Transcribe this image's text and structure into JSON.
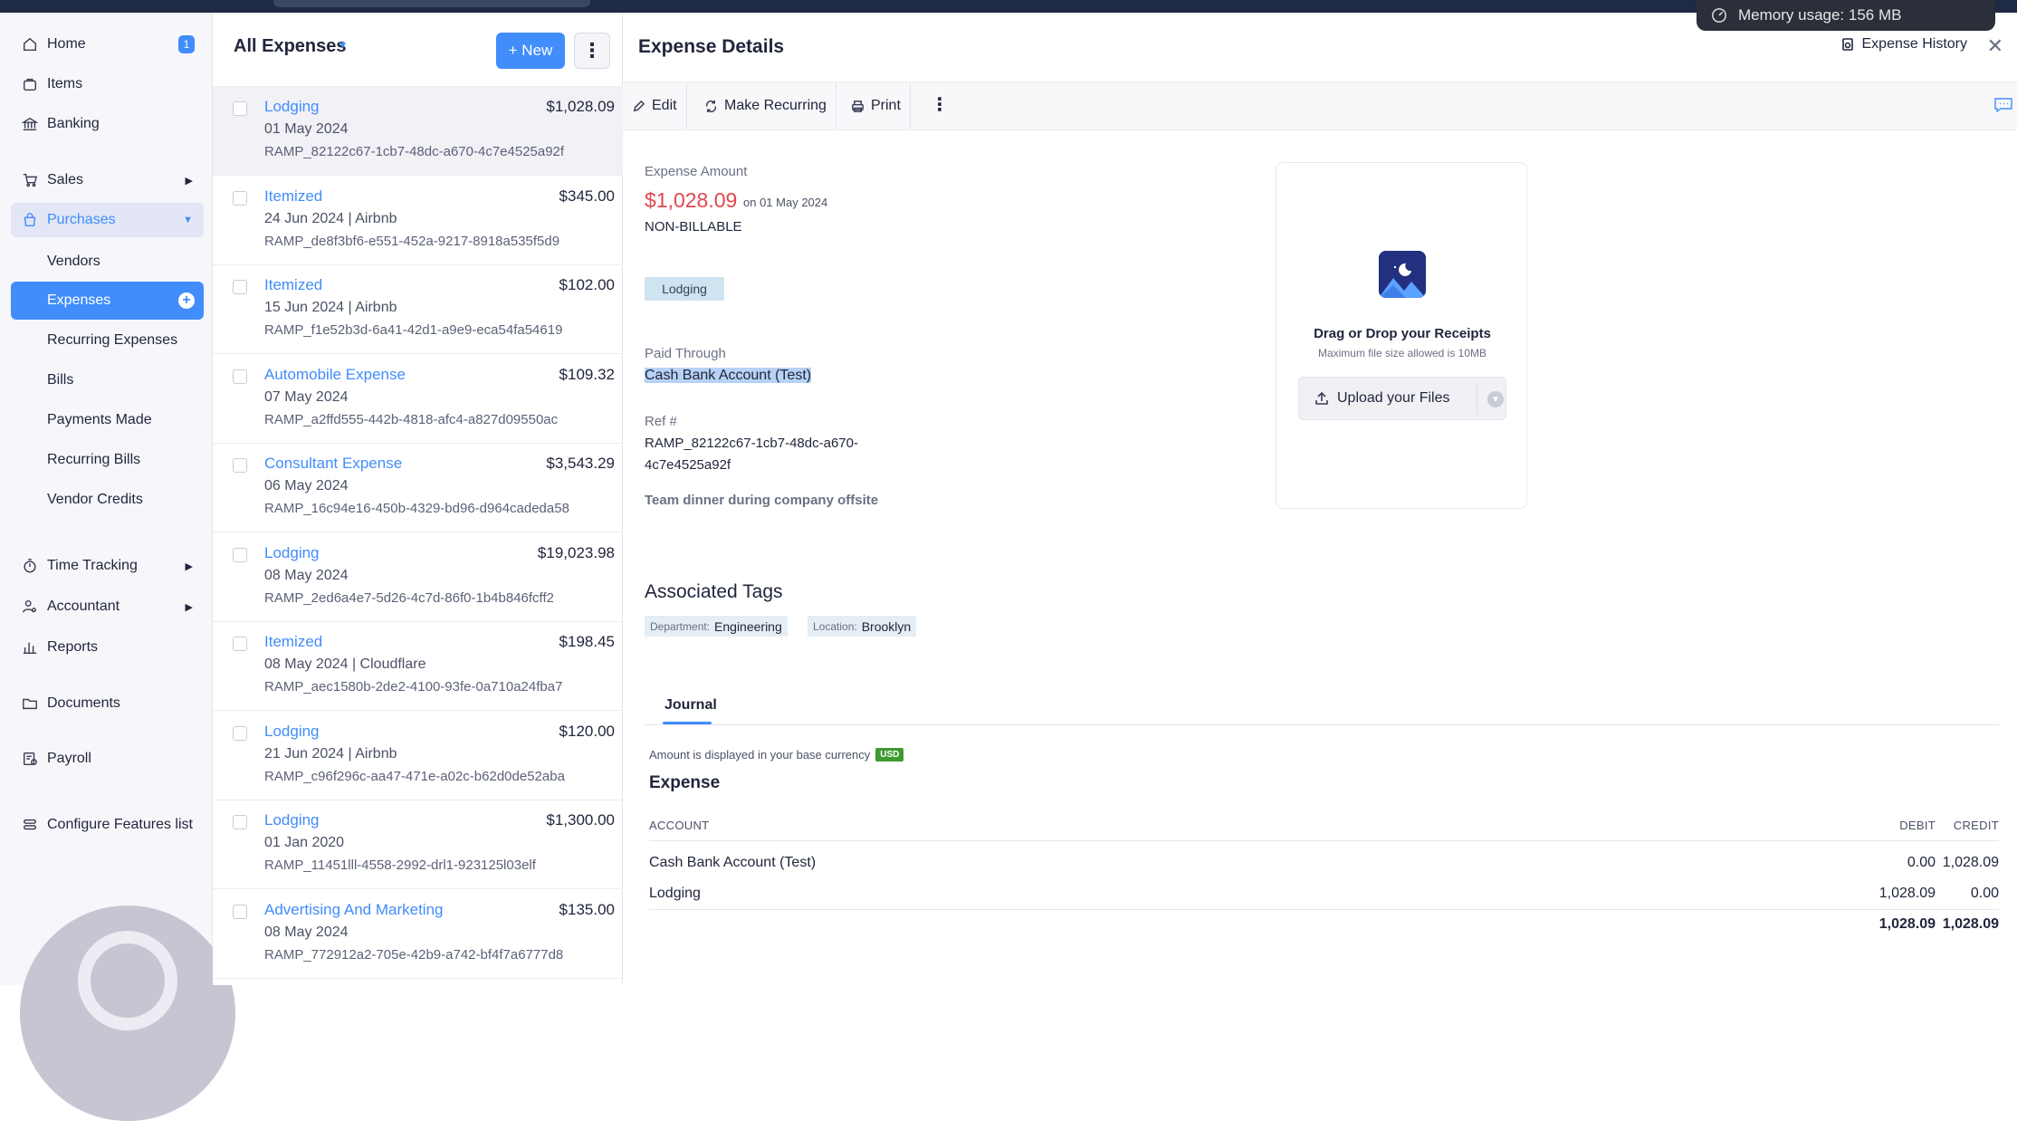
{
  "topbar": {
    "memory_usage": "Memory usage: 156 MB"
  },
  "sidebar": {
    "items": [
      {
        "label": "Home",
        "badge": "1"
      },
      {
        "label": "Items"
      },
      {
        "label": "Banking"
      },
      {
        "label": "Sales"
      },
      {
        "label": "Purchases"
      },
      {
        "label": "Time Tracking"
      },
      {
        "label": "Accountant"
      },
      {
        "label": "Reports"
      },
      {
        "label": "Documents"
      },
      {
        "label": "Payroll"
      },
      {
        "label": "Configure Features list"
      }
    ],
    "purchases_sub": [
      "Vendors",
      "Expenses",
      "Recurring Expenses",
      "Bills",
      "Payments Made",
      "Recurring Bills",
      "Vendor Credits"
    ]
  },
  "list": {
    "title": "All Expenses",
    "new_label": "+ New",
    "rows": [
      {
        "category": "Lodging",
        "amount": "$1,028.09",
        "date": "01 May 2024",
        "ref": "RAMP_82122c67-1cb7-48dc-a670-4c7e4525a92f"
      },
      {
        "category": "Itemized",
        "amount": "$345.00",
        "date": "24 Jun 2024 | Airbnb",
        "ref": "RAMP_de8f3bf6-e551-452a-9217-8918a535f5d9"
      },
      {
        "category": "Itemized",
        "amount": "$102.00",
        "date": "15 Jun 2024 | Airbnb",
        "ref": "RAMP_f1e52b3d-6a41-42d1-a9e9-eca54fa54619"
      },
      {
        "category": "Automobile Expense",
        "amount": "$109.32",
        "date": "07 May 2024",
        "ref": "RAMP_a2ffd555-442b-4818-afc4-a827d09550ac"
      },
      {
        "category": "Consultant Expense",
        "amount": "$3,543.29",
        "date": "06 May 2024",
        "ref": "RAMP_16c94e16-450b-4329-bd96-d964cadeda58"
      },
      {
        "category": "Lodging",
        "amount": "$19,023.98",
        "date": "08 May 2024",
        "ref": "RAMP_2ed6a4e7-5d26-4c7d-86f0-1b4b846fcff2"
      },
      {
        "category": "Itemized",
        "amount": "$198.45",
        "date": "08 May 2024 | Cloudflare",
        "ref": "RAMP_aec1580b-2de2-4100-93fe-0a710a24fba7"
      },
      {
        "category": "Lodging",
        "amount": "$120.00",
        "date": "21 Jun 2024 | Airbnb",
        "ref": "RAMP_c96f296c-aa47-471e-a02c-b62d0de52aba"
      },
      {
        "category": "Lodging",
        "amount": "$1,300.00",
        "date": "01 Jan 2020",
        "ref": "RAMP_11451lll-4558-2992-drl1-923125l03elf"
      },
      {
        "category": "Advertising And Marketing",
        "amount": "$135.00",
        "date": "08 May 2024",
        "ref": "RAMP_772912a2-705e-42b9-a742-bf4f7a6777d8"
      }
    ]
  },
  "detail": {
    "title": "Expense Details",
    "history_label": "Expense History",
    "toolbar": {
      "edit": "Edit",
      "make_recurring": "Make Recurring",
      "print": "Print"
    },
    "amount_label": "Expense Amount",
    "amount": "$1,028.09",
    "amount_on": "on 01 May 2024",
    "billable": "NON-BILLABLE",
    "category_tag": "Lodging",
    "paid_through_label": "Paid Through",
    "paid_through": "Cash Bank Account (Test)",
    "ref_label": "Ref #",
    "ref_line1": "RAMP_82122c67-1cb7-48dc-a670-",
    "ref_line2": "4c7e4525a92f",
    "notes": "Team dinner during company offsite",
    "receipt": {
      "title": "Drag or Drop your Receipts",
      "subtitle": "Maximum file size allowed is 10MB",
      "upload": "Upload your Files"
    },
    "associated_tags_title": "Associated Tags",
    "tags": [
      {
        "key": "Department:",
        "value": "Engineering"
      },
      {
        "key": "Location:",
        "value": "Brooklyn"
      }
    ],
    "journal": {
      "tab": "Journal",
      "base_currency_note": "Amount is displayed in your base currency",
      "currency": "USD",
      "section": "Expense",
      "headers": [
        "ACCOUNT",
        "DEBIT",
        "CREDIT"
      ],
      "rows": [
        {
          "account": "Cash Bank Account (Test)",
          "debit": "0.00",
          "credit": "1,028.09"
        },
        {
          "account": "Lodging",
          "debit": "1,028.09",
          "credit": "0.00"
        }
      ],
      "total_debit": "1,028.09",
      "total_credit": "1,028.09"
    }
  },
  "colors": {
    "accent": "#408dfb",
    "amount_red": "#e0484f",
    "usd_green": "#3f9a2f"
  }
}
